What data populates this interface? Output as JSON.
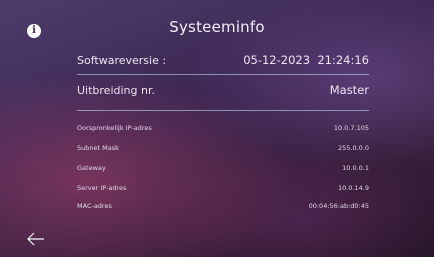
{
  "header": {
    "title": "Systeeminfo",
    "info_icon": "info-icon"
  },
  "primary_rows": [
    {
      "label": "Softwareversie :",
      "value": "05-12-2023  21:24:16"
    },
    {
      "label": "Uitbreiding nr.",
      "value": "Master"
    }
  ],
  "network_rows": [
    {
      "label": "Oorspronkelijk IP-adres",
      "value": "10.0.7.105"
    },
    {
      "label": "Subnet Mask",
      "value": "255.0.0.0"
    },
    {
      "label": "Gateway",
      "value": "10.0.0.1"
    },
    {
      "label": "Server IP-adres",
      "value": "10.0.14.9"
    },
    {
      "label": "MAC-adres",
      "value": "00:04:56:ab:d0:45"
    }
  ],
  "footer": {
    "back_icon": "back-arrow-icon"
  },
  "colors": {
    "background": "#3d2752",
    "divider": "#bed7eb",
    "text": "#ffffff"
  }
}
